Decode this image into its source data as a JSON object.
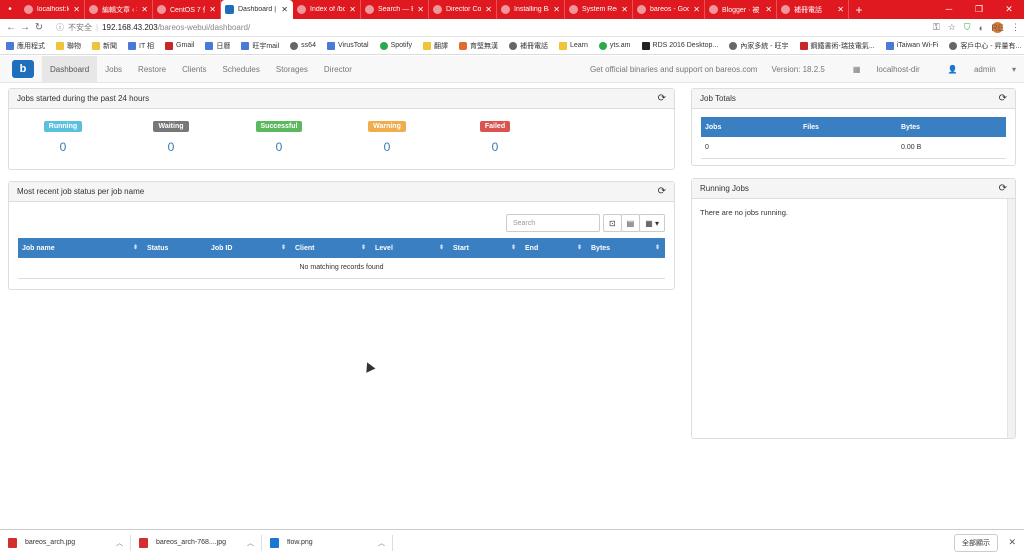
{
  "browser": {
    "tabs": [
      {
        "label": "localhost:loc"
      },
      {
        "label": "編輯文章 ‹ 被"
      },
      {
        "label": "CentOS 7 佈"
      },
      {
        "label": "Dashboard |",
        "active": true
      },
      {
        "label": "Index of /bo"
      },
      {
        "label": "Search — Ba"
      },
      {
        "label": "Director Con"
      },
      {
        "label": "Installing Ba"
      },
      {
        "label": "System Requ"
      },
      {
        "label": "bareos - Goo"
      },
      {
        "label": "Blogger · 被"
      },
      {
        "label": "補冊電話"
      }
    ],
    "address": {
      "security": "不安全",
      "host": "192.168.43.203",
      "path": "/bareos-webui/dashboard/"
    },
    "bookmarks": [
      {
        "label": "應用程式",
        "icon": "apps-icon"
      },
      {
        "label": "聯物",
        "icon": "folder-icon"
      },
      {
        "label": "新聞",
        "icon": "folder-icon"
      },
      {
        "label": "IT 相",
        "icon": "folder-icon"
      },
      {
        "label": "Gmail",
        "icon": "gmail-icon"
      },
      {
        "label": "日曆",
        "icon": "calendar-icon"
      },
      {
        "label": "旺宇mail",
        "icon": "mail-icon"
      },
      {
        "label": "ss64",
        "icon": "site-icon"
      },
      {
        "label": "VirusTotal",
        "icon": "virustotal-icon"
      },
      {
        "label": "Spotify",
        "icon": "spotify-icon"
      },
      {
        "label": "翻譯",
        "icon": "folder-icon"
      },
      {
        "label": "育堅無漢",
        "icon": "blogger-icon"
      },
      {
        "label": "補冊電話",
        "icon": "site-icon"
      },
      {
        "label": "Learn",
        "icon": "folder-icon"
      },
      {
        "label": "yts.am",
        "icon": "site-icon"
      },
      {
        "label": "RDS 2016 Desktop...",
        "icon": "site-icon"
      },
      {
        "label": "內家多統 - 旺宇",
        "icon": "site-icon"
      },
      {
        "label": "鋼鐵書術-瑞技電氣...",
        "icon": "site-icon"
      },
      {
        "label": "iTaiwan Wi-Fi",
        "icon": "site-icon"
      },
      {
        "label": "客戶中心 - 昇量有...",
        "icon": "site-icon"
      }
    ],
    "profile_initials": "RE"
  },
  "navbar": {
    "items": [
      "Dashboard",
      "Jobs",
      "Restore",
      "Clients",
      "Schedules",
      "Storages",
      "Director"
    ],
    "support_text": "Get official binaries and support on bareos.com",
    "version": "Version: 18.2.5",
    "director": "localhost-dir",
    "user": "admin"
  },
  "jobs_panel": {
    "title": "Jobs started during the past 24 hours",
    "statuses": [
      {
        "label": "Running",
        "count": "0",
        "color": "#5bc0de"
      },
      {
        "label": "Waiting",
        "count": "0",
        "color": "#777777"
      },
      {
        "label": "Successful",
        "count": "0",
        "color": "#5cb85c"
      },
      {
        "label": "Warning",
        "count": "0",
        "color": "#f0ad4e"
      },
      {
        "label": "Failed",
        "count": "0",
        "color": "#d9534f"
      }
    ]
  },
  "recent_panel": {
    "title": "Most recent job status per job name",
    "search_placeholder": "Search",
    "columns": [
      "Job name",
      "Status",
      "Job ID",
      "Client",
      "Level",
      "Start",
      "End",
      "Bytes"
    ],
    "empty_text": "No matching records found"
  },
  "totals_panel": {
    "title": "Job Totals",
    "columns": [
      "Jobs",
      "Files",
      "Bytes"
    ],
    "values": [
      "0",
      "",
      "0.00 B"
    ]
  },
  "running_panel": {
    "title": "Running Jobs",
    "empty_text": "There are no jobs running."
  },
  "downloads": {
    "items": [
      {
        "name": "bareos_arch.jpg"
      },
      {
        "name": "bareos_arch-768....jpg"
      },
      {
        "name": "flow.png"
      }
    ],
    "show_all": "全部顯示"
  }
}
